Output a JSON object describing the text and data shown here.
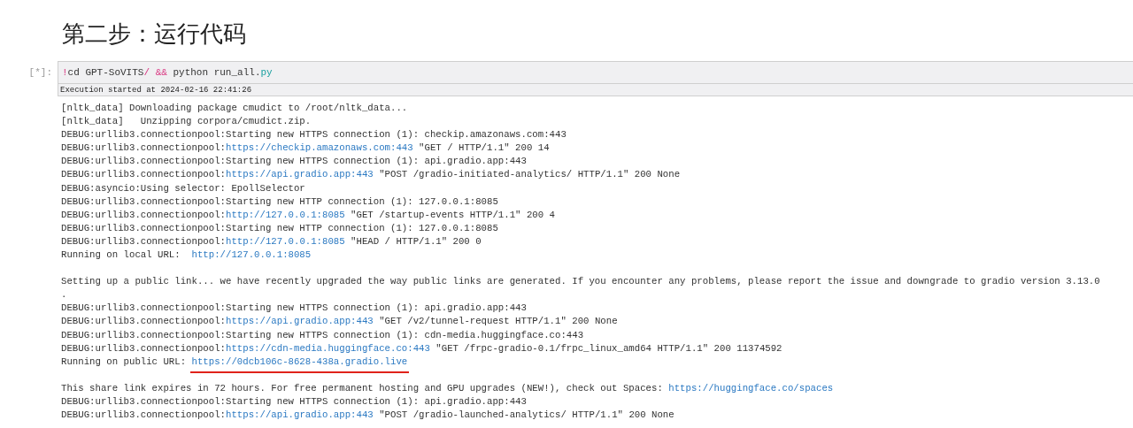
{
  "heading": "第二步：运行代码",
  "cell": {
    "prompt": "[*]:",
    "code": [
      {
        "text": "!",
        "kind": "operator"
      },
      {
        "text": "cd GPT-SoVITS",
        "kind": "plain"
      },
      {
        "text": "/",
        "kind": "operator"
      },
      {
        "text": " &&",
        "kind": "operator"
      },
      {
        "text": " python run_all.",
        "kind": "plain"
      },
      {
        "text": "py",
        "kind": "attribute"
      }
    ],
    "execution": "Execution started at 2024-02-16 22:41:26",
    "output_blocks": [
      {
        "lines": [
          [
            {
              "text": "[nltk_data] Downloading package cmudict to /root/nltk_data...",
              "kind": "plain"
            }
          ],
          [
            {
              "text": "[nltk_data]   Unzipping corpora/cmudict.zip.",
              "kind": "plain"
            }
          ],
          [
            {
              "text": "DEBUG:urllib3.connectionpool:Starting new HTTPS connection (1): checkip.amazonaws.com:443",
              "kind": "plain"
            }
          ],
          [
            {
              "text": "DEBUG:urllib3.connectionpool:",
              "kind": "plain"
            },
            {
              "text": "https://checkip.amazonaws.com:443",
              "kind": "link"
            },
            {
              "text": " \"GET / HTTP/1.1\" 200 14",
              "kind": "plain"
            }
          ],
          [
            {
              "text": "DEBUG:urllib3.connectionpool:Starting new HTTPS connection (1): api.gradio.app:443",
              "kind": "plain"
            }
          ],
          [
            {
              "text": "DEBUG:urllib3.connectionpool:",
              "kind": "plain"
            },
            {
              "text": "https://api.gradio.app:443",
              "kind": "link"
            },
            {
              "text": " \"POST /gradio-initiated-analytics/ HTTP/1.1\" 200 None",
              "kind": "plain"
            }
          ],
          [
            {
              "text": "DEBUG:asyncio:Using selector: EpollSelector",
              "kind": "plain"
            }
          ],
          [
            {
              "text": "DEBUG:urllib3.connectionpool:Starting new HTTP connection (1): 127.0.0.1:8085",
              "kind": "plain"
            }
          ],
          [
            {
              "text": "DEBUG:urllib3.connectionpool:",
              "kind": "plain"
            },
            {
              "text": "http://127.0.0.1:8085",
              "kind": "link"
            },
            {
              "text": " \"GET /startup-events HTTP/1.1\" 200 4",
              "kind": "plain"
            }
          ],
          [
            {
              "text": "DEBUG:urllib3.connectionpool:Starting new HTTP connection (1): 127.0.0.1:8085",
              "kind": "plain"
            }
          ],
          [
            {
              "text": "DEBUG:urllib3.connectionpool:",
              "kind": "plain"
            },
            {
              "text": "http://127.0.0.1:8085",
              "kind": "link"
            },
            {
              "text": " \"HEAD / HTTP/1.1\" 200 0",
              "kind": "plain"
            }
          ],
          [
            {
              "text": "Running on local URL:  ",
              "kind": "plain"
            },
            {
              "text": "http://127.0.0.1:8085",
              "kind": "link"
            }
          ]
        ]
      },
      {
        "lines": [
          [
            {
              "text": "Setting up a public link... we have recently upgraded the way public links are generated. If you encounter any problems, please report the issue and downgrade to gradio version 3.13.0",
              "kind": "plain"
            }
          ],
          [
            {
              "text": ".",
              "kind": "plain"
            }
          ],
          [
            {
              "text": "DEBUG:urllib3.connectionpool:Starting new HTTPS connection (1): api.gradio.app:443",
              "kind": "plain"
            }
          ],
          [
            {
              "text": "DEBUG:urllib3.connectionpool:",
              "kind": "plain"
            },
            {
              "text": "https://api.gradio.app:443",
              "kind": "link"
            },
            {
              "text": " \"GET /v2/tunnel-request HTTP/1.1\" 200 None",
              "kind": "plain"
            }
          ],
          [
            {
              "text": "DEBUG:urllib3.connectionpool:Starting new HTTPS connection (1): cdn-media.huggingface.co:443",
              "kind": "plain"
            }
          ],
          [
            {
              "text": "DEBUG:urllib3.connectionpool:",
              "kind": "plain"
            },
            {
              "text": "https://cdn-media.huggingface.co:443",
              "kind": "link"
            },
            {
              "text": " \"GET /frpc-gradio-0.1/frpc_linux_amd64 HTTP/1.1\" 200 11374592",
              "kind": "plain"
            }
          ],
          [
            {
              "text": "Running on public URL: ",
              "kind": "plain"
            },
            {
              "text": "https://0dcb106c-8628-438a.gradio.live",
              "kind": "link",
              "underlined": true
            }
          ]
        ]
      },
      {
        "lines": [
          [
            {
              "text": "This share link expires in 72 hours. For free permanent hosting and GPU upgrades (NEW!), check out Spaces: ",
              "kind": "plain"
            },
            {
              "text": "https://huggingface.co/spaces",
              "kind": "link"
            }
          ],
          [
            {
              "text": "DEBUG:urllib3.connectionpool:Starting new HTTPS connection (1): api.gradio.app:443",
              "kind": "plain"
            }
          ],
          [
            {
              "text": "DEBUG:urllib3.connectionpool:",
              "kind": "plain"
            },
            {
              "text": "https://api.gradio.app:443",
              "kind": "link"
            },
            {
              "text": " \"POST /gradio-launched-analytics/ HTTP/1.1\" 200 None",
              "kind": "plain"
            }
          ]
        ]
      }
    ]
  }
}
